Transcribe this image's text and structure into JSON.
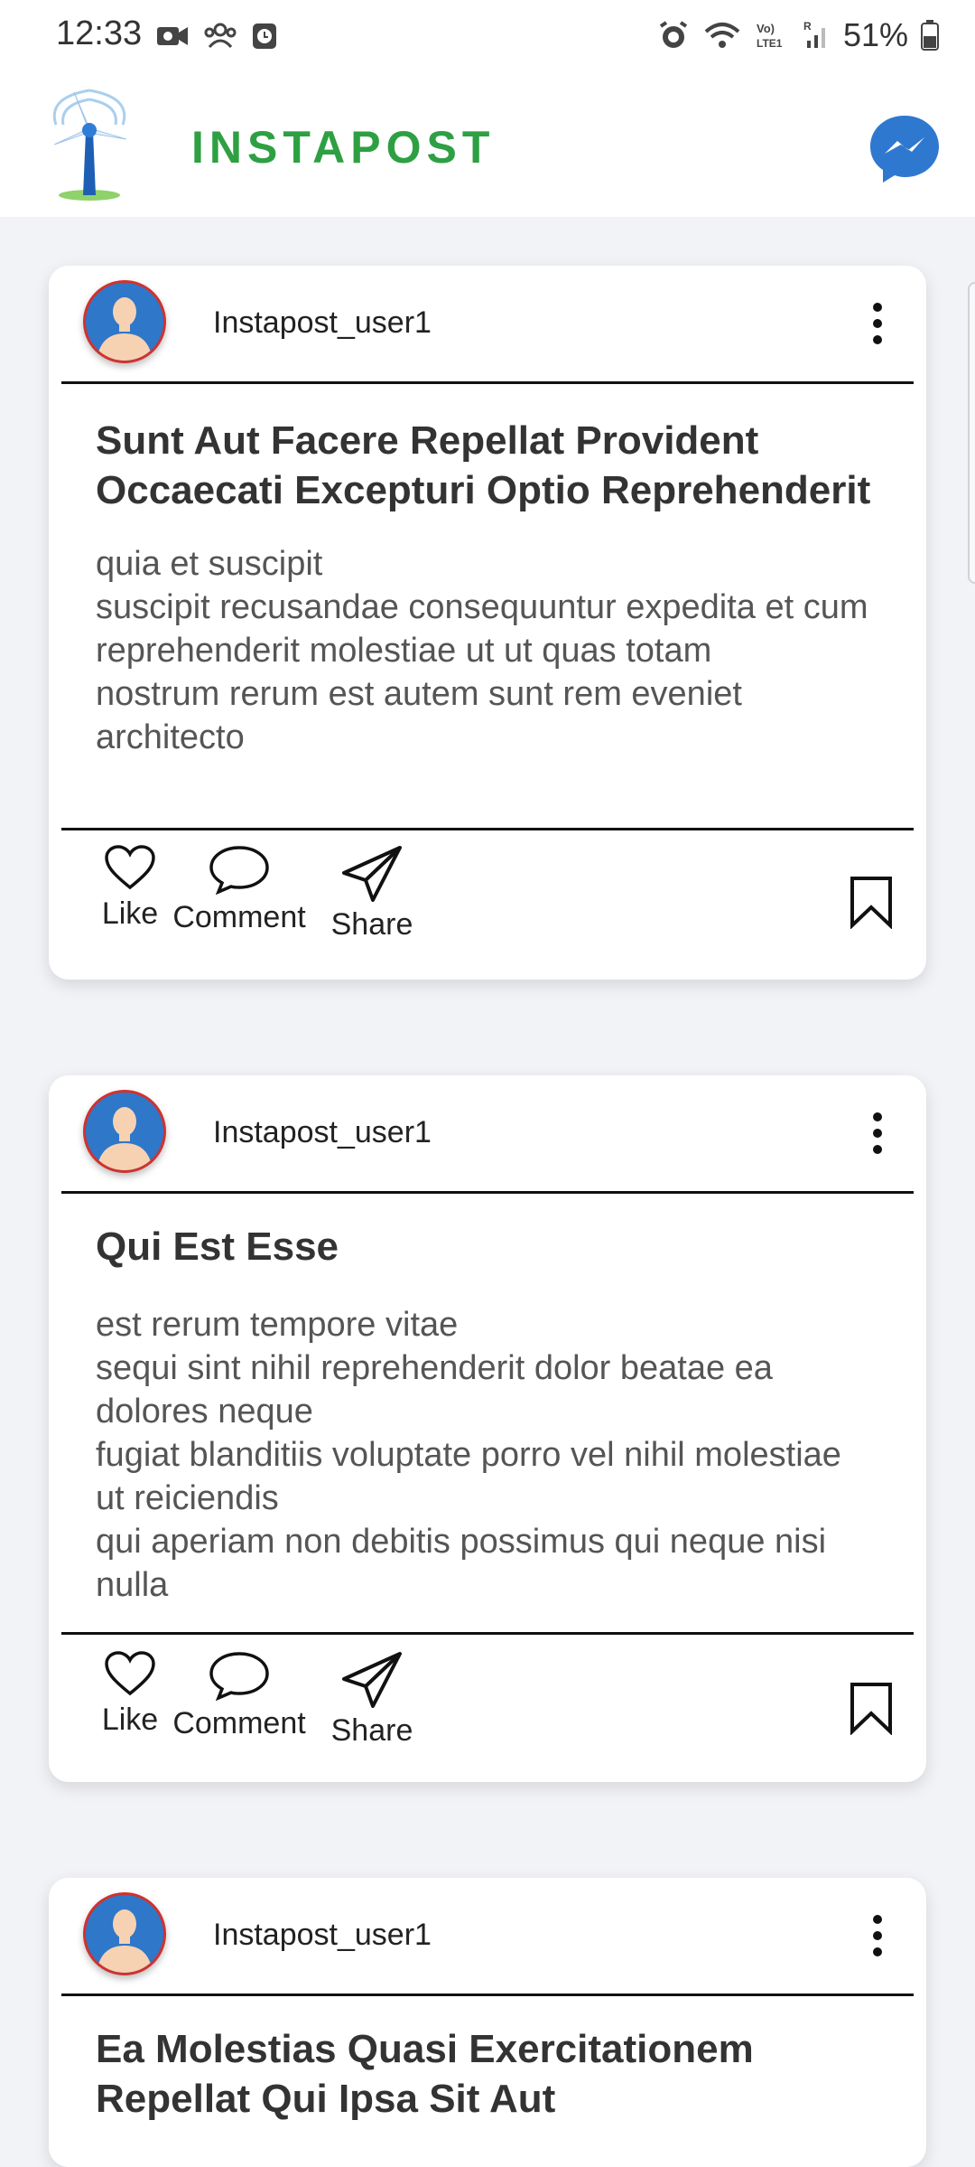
{
  "status_bar": {
    "time": "12:33",
    "battery": "51%",
    "icons": [
      "video-call-icon",
      "people-icon",
      "clock-app-icon",
      "alarm-icon",
      "wifi-icon",
      "volte-lte-icon",
      "signal-icon",
      "battery-icon"
    ]
  },
  "app_bar": {
    "title": "INSTAPOST",
    "title_color": "#2ea043",
    "logo_icon": "wind-turbine-icon",
    "messenger_icon": "messenger-icon",
    "messenger_color": "#2f78d0"
  },
  "posts": [
    {
      "username": "Instapost_user1",
      "title": "Sunt Aut Facere Repellat Provident Occaecati Excepturi Optio Reprehenderit",
      "body": "quia et suscipit\nsuscipit recusandae consequuntur expedita et cum\nreprehenderit molestiae ut ut quas totam\nnostrum rerum est autem sunt rem eveniet architecto",
      "actions": {
        "like": "Like",
        "comment": "Comment",
        "share": "Share"
      }
    },
    {
      "username": "Instapost_user1",
      "title": "Qui Est Esse",
      "body": "est rerum tempore vitae\nsequi sint nihil reprehenderit dolor beatae ea dolores neque\nfugiat blanditiis voluptate porro vel nihil molestiae ut reiciendis\nqui aperiam non debitis possimus qui neque nisi nulla",
      "actions": {
        "like": "Like",
        "comment": "Comment",
        "share": "Share"
      }
    },
    {
      "username": "Instapost_user1",
      "title": "Ea Molestias Quasi Exercitationem Repellat Qui Ipsa Sit Aut"
    }
  ]
}
